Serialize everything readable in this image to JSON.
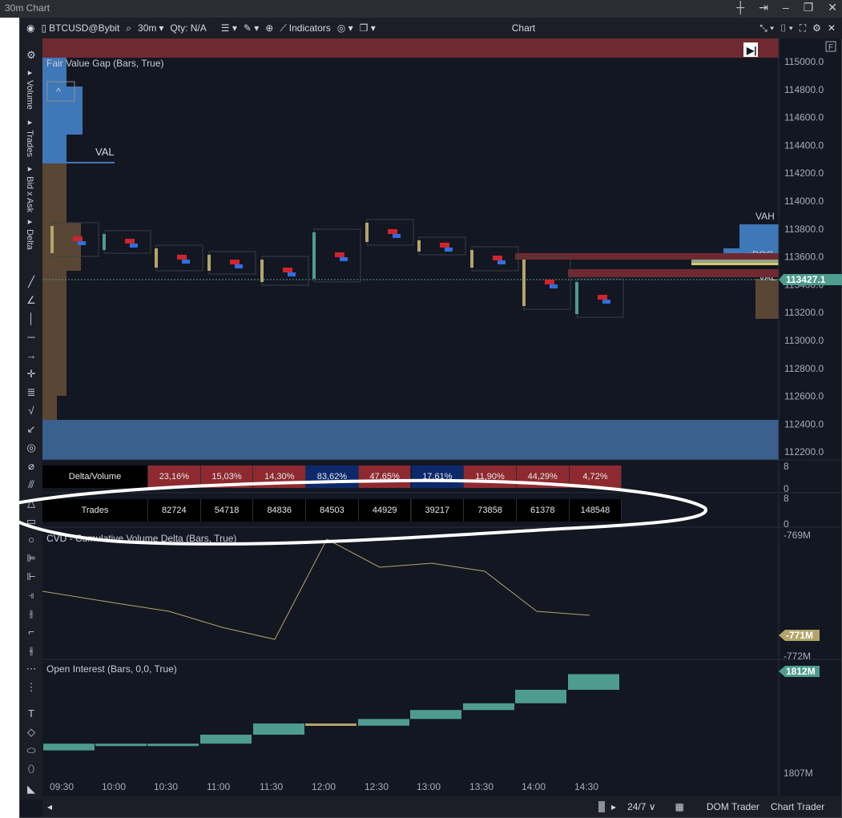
{
  "window": {
    "title": "30m Chart"
  },
  "toolbar": {
    "symbol": "BTCUSD@Bybit",
    "timeframe": "30m",
    "qty": "Qty: N/A",
    "indicators": "Indicators",
    "center_title": "Chart"
  },
  "left_tabs": [
    "Volume",
    "Trades",
    "Bid x Ask",
    "Delta"
  ],
  "main_pane": {
    "indicator_title": "Fair Value Gap (Bars, True)",
    "val_left": "VAL",
    "vah_right": "VAH",
    "vpoc_right": "vPOC",
    "val_right": "VAL",
    "current_price": "113427.1",
    "price_axis": [
      "115000.0",
      "114800.0",
      "114600.0",
      "114400.0",
      "114200.0",
      "114000.0",
      "113800.0",
      "113600.0",
      "113400.0",
      "113200.0",
      "113000.0",
      "112800.0",
      "112600.0",
      "112400.0",
      "112200.0"
    ],
    "f_badge": "F"
  },
  "delta_volume_row": {
    "label": "Delta/Volume",
    "values": [
      "23,16%",
      "15,03%",
      "14,30%",
      "83,62%",
      "47,65%",
      "17,61%",
      "11,90%",
      "44,29%",
      "4,72%"
    ],
    "colors": [
      "#8e2a2f",
      "#8e2a2f",
      "#8e2a2f",
      "#0c2a6b",
      "#8e2a2f",
      "#0c2a6b",
      "#8e2a2f",
      "#8e2a2f",
      "#8e2a2f"
    ],
    "axis_top": "8",
    "axis_bottom": "0"
  },
  "trades_row": {
    "label": "Trades",
    "values": [
      "82724",
      "54718",
      "84836",
      "84503",
      "44929",
      "39217",
      "73858",
      "61378",
      "148548"
    ],
    "axis_top": "8",
    "axis_bottom": "0"
  },
  "cvd_pane": {
    "title": "CVD - Cumulative Volume Delta (Bars, True)",
    "axis_top": "-769M",
    "axis_bottom": "-772M",
    "current": "-771M"
  },
  "oi_pane": {
    "title": "Open Interest (Bars, 0,0, True)",
    "axis_top": "1812M",
    "axis_bottom": "1807M",
    "current": "1812M"
  },
  "time_axis": [
    "09:30",
    "10:00",
    "10:30",
    "11:00",
    "11:30",
    "12:00",
    "12:30",
    "13:00",
    "13:30",
    "14:00",
    "14:30"
  ],
  "bottom_bar": {
    "session": "24/7",
    "dom_trader": "DOM Trader",
    "chart_trader": "Chart Trader"
  },
  "colors": {
    "bg": "#131722",
    "bull": "#4e9c8e",
    "bear": "#b5a46a",
    "red": "#8e2a2f",
    "blue": "#0c2a6b",
    "price_tag": "#4e9c8e",
    "cvd_tag": "#b5a46a"
  },
  "chart_data": [
    {
      "type": "line",
      "title": "CVD - Cumulative Volume Delta (Bars, True)",
      "x": [
        "09:30",
        "10:00",
        "10:30",
        "11:00",
        "11:30",
        "12:00",
        "12:30",
        "13:00",
        "13:30",
        "14:00",
        "14:30"
      ],
      "series": [
        {
          "values": [
            -770.4,
            -770.7,
            -770.9,
            -771.3,
            -771.6,
            -769.1,
            -769.8,
            -769.7,
            -769.9,
            -770.9,
            -771.0
          ]
        }
      ],
      "ylim": [
        -772,
        -769
      ]
    },
    {
      "type": "bar",
      "title": "Open Interest (Bars, 0,0, True)",
      "categories": [
        "09:30",
        "10:00",
        "10:30",
        "11:00",
        "11:30",
        "12:00",
        "12:30",
        "13:00",
        "13:30",
        "14:00",
        "14:30"
      ],
      "series": [
        {
          "values": [
            1808.6,
            1808.6,
            1808.6,
            1809.0,
            1809.5,
            1809.4,
            1809.7,
            1810.1,
            1810.4,
            1811.0,
            1811.7
          ]
        }
      ],
      "ylim": [
        1807,
        1812
      ]
    }
  ]
}
